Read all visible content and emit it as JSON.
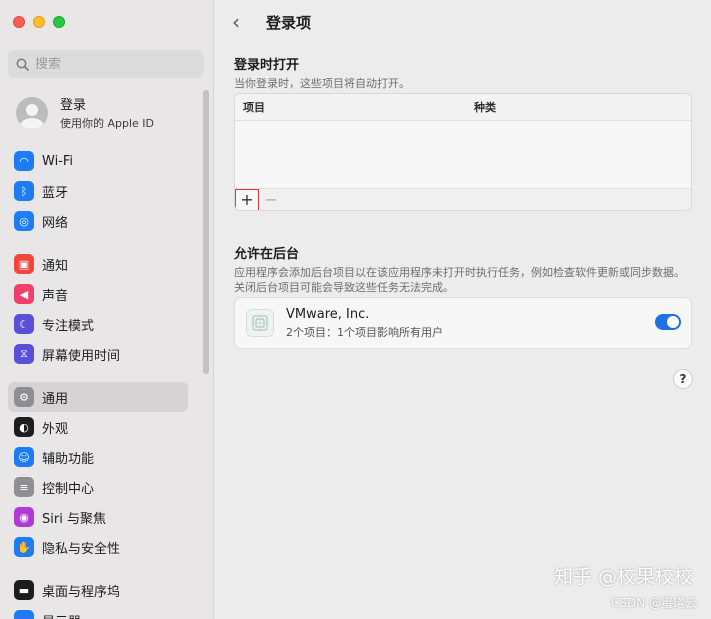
{
  "sidebar": {
    "search_placeholder": "搜索",
    "account": {
      "title": "登录",
      "subtitle": "使用你的 Apple ID"
    },
    "groups": [
      [
        {
          "label": "Wi-Fi",
          "icon": "wifi-icon",
          "color": "#1e7cf2"
        },
        {
          "label": "蓝牙",
          "icon": "bluetooth-icon",
          "color": "#1e7cf2"
        },
        {
          "label": "网络",
          "icon": "globe-icon",
          "color": "#1e7cf2"
        }
      ],
      [
        {
          "label": "通知",
          "icon": "notification-icon",
          "color": "#f2453d"
        },
        {
          "label": "声音",
          "icon": "sound-icon",
          "color": "#ef3f6b"
        },
        {
          "label": "专注模式",
          "icon": "moon-icon",
          "color": "#5b4ed9"
        },
        {
          "label": "屏幕使用时间",
          "icon": "hourglass-icon",
          "color": "#5b4ed9"
        }
      ],
      [
        {
          "label": "通用",
          "icon": "gear-icon",
          "color": "#8e8e93",
          "active": true
        },
        {
          "label": "外观",
          "icon": "appearance-icon",
          "color": "#1d1d1f"
        },
        {
          "label": "辅助功能",
          "icon": "accessibility-icon",
          "color": "#1e7cf2"
        },
        {
          "label": "控制中心",
          "icon": "control-center-icon",
          "color": "#8e8e93"
        },
        {
          "label": "Siri 与聚焦",
          "icon": "siri-icon",
          "color": "#b03ad4"
        },
        {
          "label": "隐私与安全性",
          "icon": "hand-icon",
          "color": "#1e7cf2"
        }
      ],
      [
        {
          "label": "桌面与程序坞",
          "icon": "dock-icon",
          "color": "#1d1d1f"
        },
        {
          "label": "显示器",
          "icon": "display-icon",
          "color": "#1e7cf2"
        }
      ]
    ]
  },
  "header": {
    "title": "登录项"
  },
  "login_section": {
    "title": "登录时打开",
    "description": "当你登录时，这些项目将自动打开。",
    "columns": {
      "name": "项目",
      "kind": "种类"
    },
    "add_label": "+",
    "remove_label": "−"
  },
  "background_section": {
    "title": "允许在后台",
    "description": "应用程序会添加后台项目以在该应用程序未打开时执行任务，例如检查软件更新或同步数据。关闭后台项目可能会导致这些任务无法完成。",
    "items": [
      {
        "name": "VMware, Inc.",
        "subtitle": "2个项目：1个项目影响所有用户",
        "enabled": true
      }
    ]
  },
  "help_label": "?",
  "watermark": {
    "line1": "知乎 @校果校校",
    "line2": "CSDN @蜜罐云"
  }
}
